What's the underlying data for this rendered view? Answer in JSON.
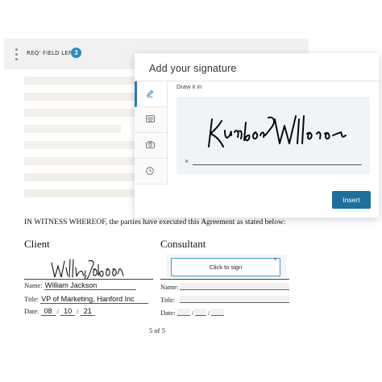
{
  "toolbar": {
    "req_label": "REQ' FIELD LEFT",
    "req_count": "3"
  },
  "modal": {
    "title": "Add your signature",
    "draw_label": "Draw it in",
    "clear_glyph": "×",
    "insert_label": "Insert",
    "tabs": [
      {
        "icon": "pen-icon",
        "active": true
      },
      {
        "icon": "keyboard-icon",
        "active": false
      },
      {
        "icon": "camera-icon",
        "active": false
      },
      {
        "icon": "clock-icon",
        "active": false
      }
    ]
  },
  "document": {
    "witness_text": "IN WITNESS WHEREOF, the parties have executed this Agreement as stated below:",
    "client": {
      "heading": "Client",
      "name_label": "Name:",
      "name_value": "William Jackson",
      "title_label": "Title:",
      "title_value": "VP of Marketing, Hanford Inc",
      "date_label": "Date:",
      "date_month": "08",
      "date_day": "10",
      "date_year": "21",
      "date_sep": "/"
    },
    "consultant": {
      "heading": "Consultant",
      "click_to_sign": "Click to sign",
      "required_mark": "*",
      "name_label": "Name:",
      "title_label": "Title:",
      "date_label": "Date:",
      "date_sep": "/"
    },
    "page_number": "5 of 5"
  },
  "colors": {
    "accent": "#1f8fc2",
    "button": "#1e6f9e",
    "required": "#dd0000"
  }
}
